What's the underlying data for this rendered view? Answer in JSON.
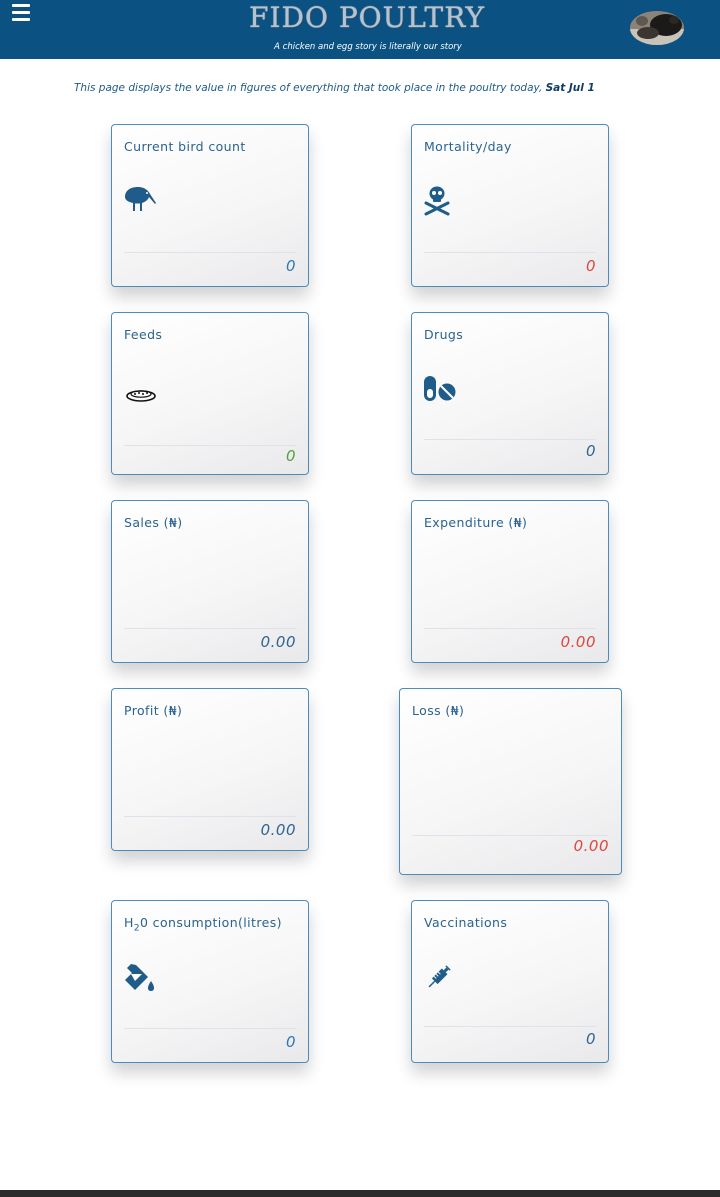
{
  "header": {
    "brand": "FIDO POULTRY",
    "tagline": "A chicken and egg story is literally our story",
    "menu_icon": "hamburger-menu-icon",
    "avatar": "profile-avatar"
  },
  "intro": {
    "text": "This page displays the value in figures of everything that took place in the poultry today, ",
    "date": "Sat Jul 1"
  },
  "cards": {
    "bird_count": {
      "title": "Current bird count",
      "value": "0",
      "icon": "kiwi-bird-icon"
    },
    "mortality": {
      "title": "Mortality/day",
      "value": "0",
      "icon": "skull-crossbones-icon"
    },
    "feeds": {
      "title": "Feeds",
      "value": "0",
      "icon": "feed-tray-icon"
    },
    "drugs": {
      "title": "Drugs",
      "value": "0",
      "icon": "pills-icon"
    },
    "sales": {
      "title": "Sales (₦)",
      "value": "0.00"
    },
    "expenditure": {
      "title": "Expenditure (₦)",
      "value": "0.00"
    },
    "profit": {
      "title": "Profit (₦)",
      "value": "0.00"
    },
    "loss": {
      "title": "Loss (₦)",
      "value": "0.00"
    },
    "water": {
      "title_main": "H",
      "title_sub": "2",
      "title_rest": "0 consumption(litres)",
      "value": "0",
      "icon": "fill-drip-icon"
    },
    "vaccinations": {
      "title": "Vaccinations",
      "value": "0",
      "icon": "syringe-icon"
    }
  },
  "colors": {
    "header_bg": "#0b5283",
    "card_border": "#4b8bbd",
    "value_red": "#e0453e",
    "value_green": "#4fa13f",
    "value_blue": "#2c78b4"
  }
}
